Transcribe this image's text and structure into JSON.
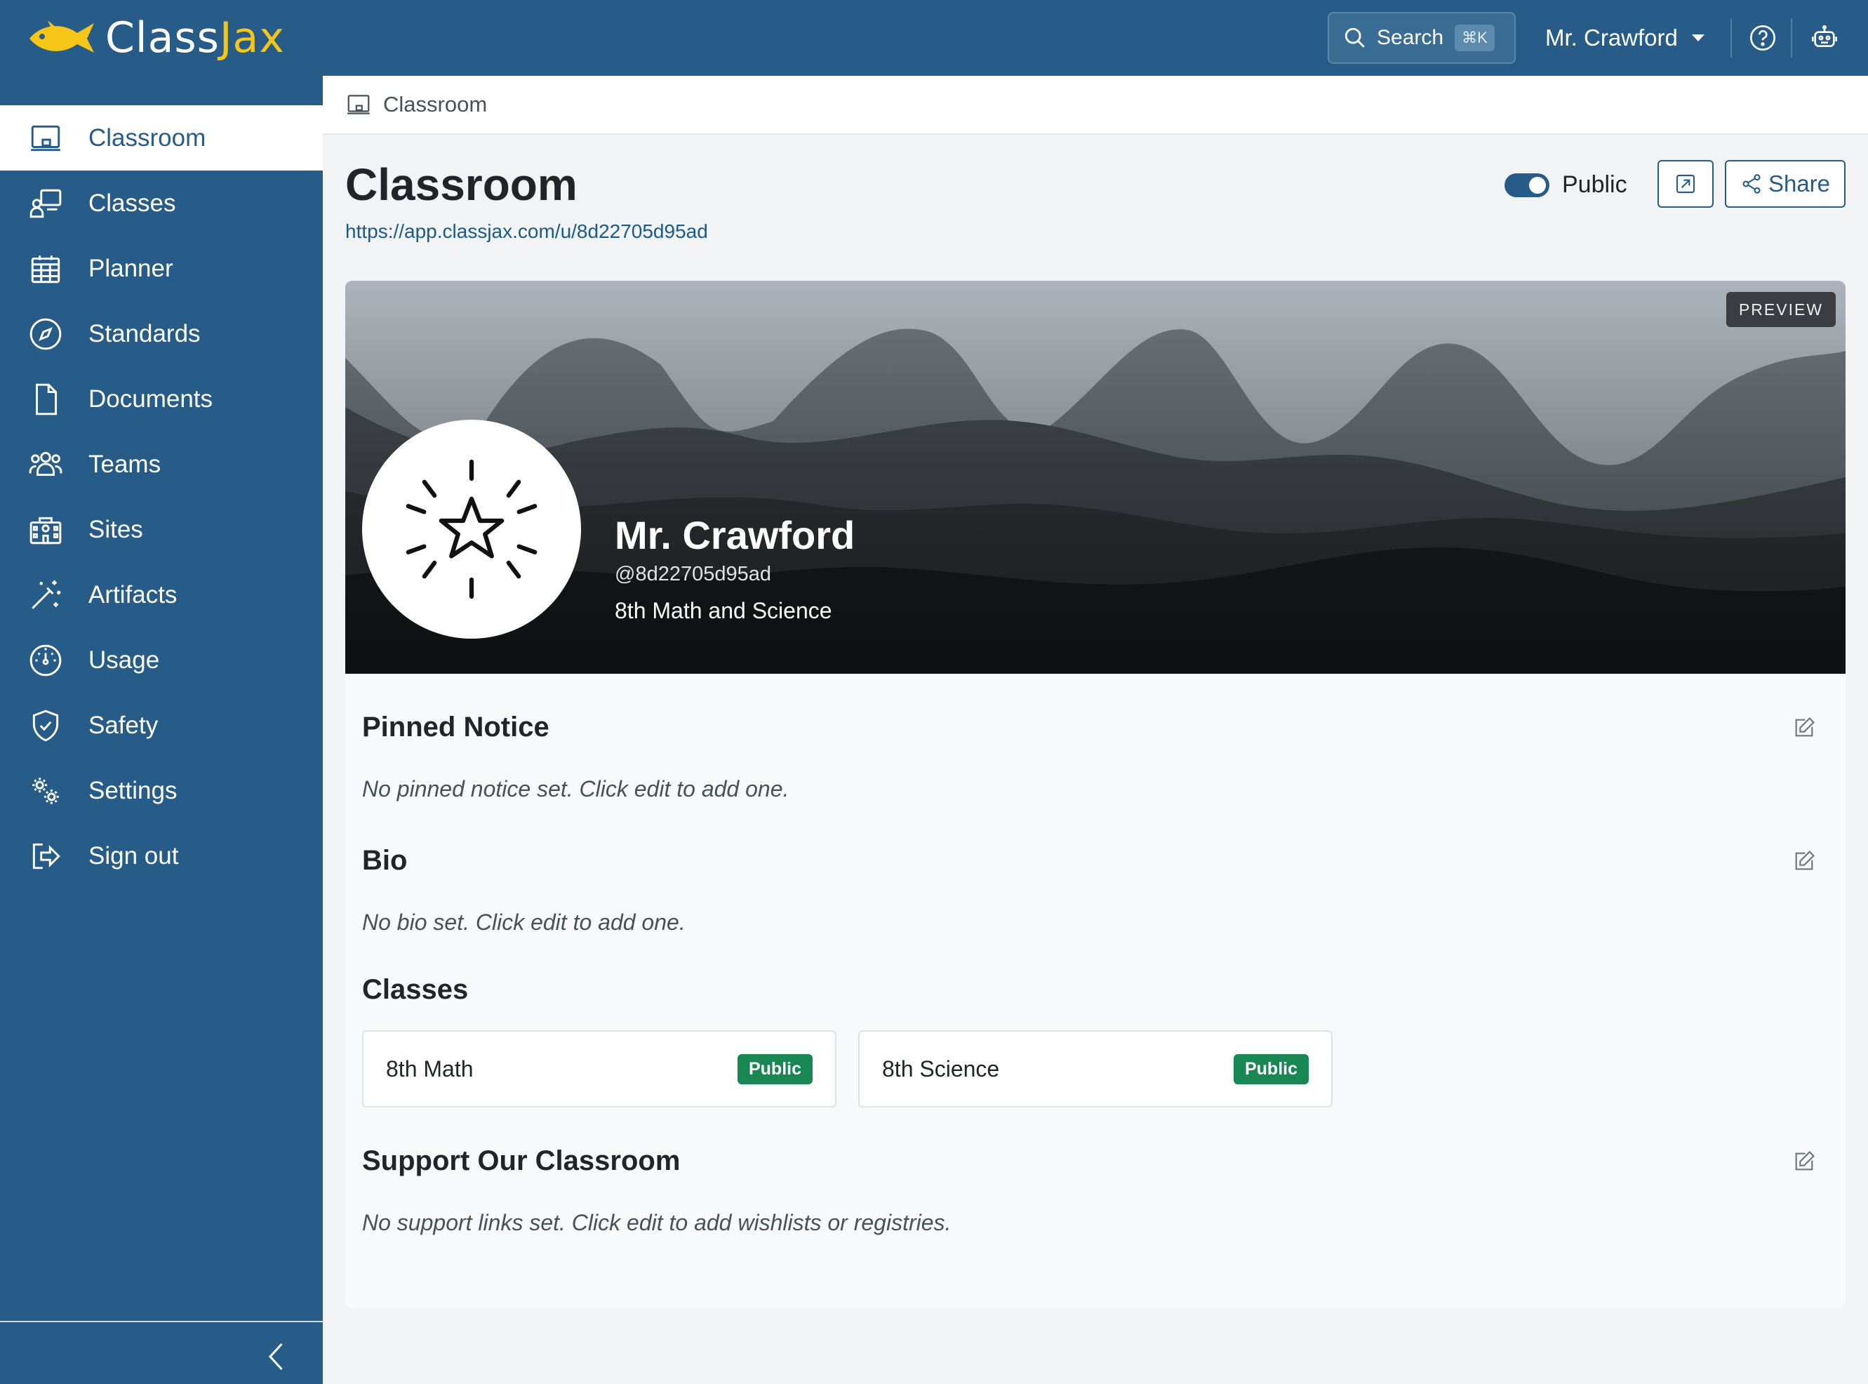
{
  "app": {
    "logo_part1": "Class",
    "logo_part2": "Jax"
  },
  "topbar": {
    "search_label": "Search",
    "search_shortcut": "⌘K",
    "user_name": "Mr. Crawford"
  },
  "sidebar": {
    "items": [
      {
        "label": "Classroom",
        "icon": "monitor-icon"
      },
      {
        "label": "Classes",
        "icon": "teacher-board-icon"
      },
      {
        "label": "Planner",
        "icon": "calendar-icon"
      },
      {
        "label": "Standards",
        "icon": "compass-icon"
      },
      {
        "label": "Documents",
        "icon": "document-icon"
      },
      {
        "label": "Teams",
        "icon": "people-icon"
      },
      {
        "label": "Sites",
        "icon": "building-icon"
      },
      {
        "label": "Artifacts",
        "icon": "magic-wand-icon"
      },
      {
        "label": "Usage",
        "icon": "speedometer-icon"
      },
      {
        "label": "Safety",
        "icon": "shield-check-icon"
      },
      {
        "label": "Settings",
        "icon": "gears-icon"
      },
      {
        "label": "Sign out",
        "icon": "sign-out-icon"
      }
    ]
  },
  "breadcrumb": {
    "label": "Classroom"
  },
  "page": {
    "title": "Classroom",
    "url": "https://app.classjax.com/u/8d22705d95ad",
    "visibility_label": "Public",
    "visibility_on": true,
    "share_label": "Share"
  },
  "profile": {
    "preview_label": "PREVIEW",
    "name": "Mr. Crawford",
    "handle": "@8d22705d95ad",
    "subtitle": "8th Math and Science"
  },
  "sections": {
    "pinned_title": "Pinned Notice",
    "pinned_empty": "No pinned notice set. Click edit to add one.",
    "bio_title": "Bio",
    "bio_empty": "No bio set. Click edit to add one.",
    "classes_title": "Classes",
    "support_title": "Support Our Classroom",
    "support_empty": "No support links set. Click edit to add wishlists or registries."
  },
  "classes": [
    {
      "name": "8th Math",
      "badge": "Public"
    },
    {
      "name": "8th Science",
      "badge": "Public"
    }
  ],
  "colors": {
    "primary": "#265c87",
    "accent": "#f5c518",
    "success": "#198754"
  }
}
